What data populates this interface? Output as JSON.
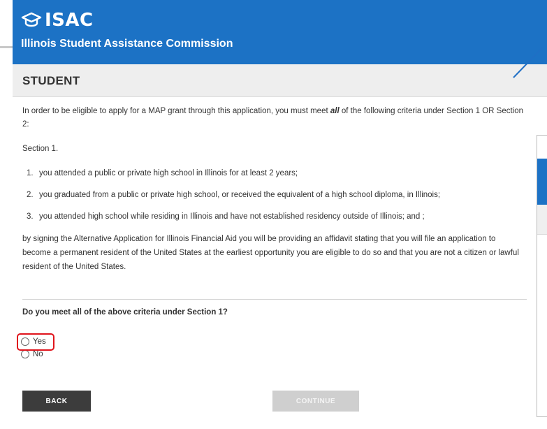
{
  "header": {
    "logo_text": "ISAC",
    "org_name": "Illinois Student Assistance Commission"
  },
  "section": {
    "title": "STUDENT"
  },
  "content": {
    "intro_before": "In order to be eligible to apply for a MAP grant through this application, you must meet ",
    "intro_emphasis": "all",
    "intro_after": " of the following criteria under Section 1 OR Section 2:",
    "section_label": "Section 1.",
    "criteria": [
      {
        "num": "1.",
        "text": "you attended a public or private high school in Illinois for at least 2 years;"
      },
      {
        "num": "2.",
        "text": "you graduated from a public or private high school, or received the equivalent of a high school diploma, in Illinois;"
      },
      {
        "num": "3.",
        "text": "you attended high school while residing in Illinois and have not established residency outside of Illinois; and ;"
      }
    ],
    "affidavit": "by signing the Alternative Application for Illinois Financial Aid you will be providing an affidavit stating that you will file an application to become a permanent resident of the United States at the earliest opportunity you are eligible to do so and that you are not a citizen or lawful resident of the United States."
  },
  "question": {
    "label": "Do you meet all of the above criteria under Section 1?",
    "options": [
      {
        "label": "Yes"
      },
      {
        "label": "No"
      }
    ]
  },
  "buttons": {
    "back": "BACK",
    "continue": "CONTINUE"
  },
  "colors": {
    "brand_blue": "#1c72c5",
    "highlight_red": "#e0141c",
    "back_button": "#3c3c3c",
    "continue_disabled": "#cfcfcf"
  }
}
